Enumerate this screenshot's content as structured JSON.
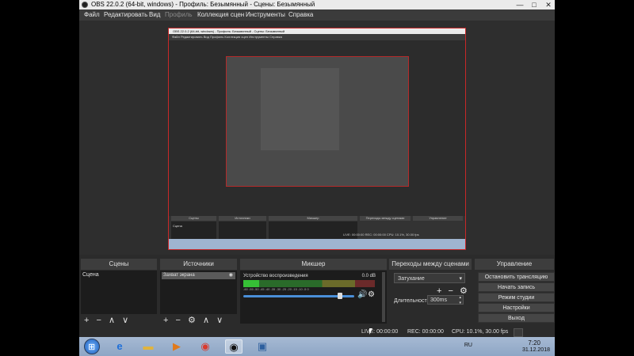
{
  "window": {
    "title": "OBS 22.0.2 (64-bit, windows) - Профиль: Безымянный - Сцены: Безымянный",
    "minimize_glyph": "—",
    "maximize_glyph": "□",
    "close_glyph": "✕"
  },
  "menu": {
    "items": [
      "Файл",
      "Редактировать",
      "Вид",
      "Профиль",
      "Коллекция сцен",
      "Инструменты",
      "Справка"
    ]
  },
  "preview": {
    "inner_title": "OBS 22.0.2 (64-bit, windows) - Профиль: Безымянный - Сцены: Безымянный",
    "inner_menu": "Файл  Редактировать  Вид  Профиль  Коллекция сцен  Инструменты  Справка",
    "inner_dock_titles": [
      "Сцены",
      "Источники",
      "Микшер",
      "Переходы между сценами",
      "Управление"
    ],
    "inner_scene_item": "Сцена",
    "inner_status": "LIVE: 00:00:00   REC: 00:00:00   CPU: 10.1%, 30.00 fps"
  },
  "docks": {
    "scenes": {
      "title": "Сцены",
      "items": [
        "Сцена"
      ],
      "controls": [
        "+",
        "−",
        "∧",
        "∨"
      ]
    },
    "sources": {
      "title": "Источники",
      "items": [
        "Захват экрана"
      ],
      "controls": [
        "+",
        "−",
        "⚙",
        "∧",
        "∨"
      ]
    },
    "mixer": {
      "title": "Микшер",
      "channel_label": "Устройство воспроизведения",
      "channel_db": "0.0 dB",
      "scale": "-60  -55  -50  -45  -40  -35  -30  -25  -20  -15  -10  -5  0",
      "volume": 0.85,
      "level": 0.12
    },
    "transitions": {
      "title": "Переходы между сценами",
      "selected": "Затухание",
      "controls": [
        "+",
        "−",
        "⚙"
      ],
      "duration_label": "Длительность",
      "duration_value": "300ms"
    },
    "controls": {
      "title": "Управление",
      "buttons": [
        "Остановить трансляцию",
        "Начать запись",
        "Режим студии",
        "Настройки",
        "Выход"
      ]
    }
  },
  "status": {
    "live": "LIVE: 00:00:00",
    "rec": "REC: 00:00:00",
    "cpu": "CPU: 10.1%, 30.00 fps"
  },
  "taskbar": {
    "start_icon": "windows-start-icon",
    "apps": [
      "windows-explorer-icon",
      "ie-icon",
      "folder-icon",
      "media-player-icon",
      "chrome-icon",
      "obs-icon",
      "image-viewer-icon"
    ],
    "language": "RU",
    "time": "7:20",
    "date": "31.12.2018"
  },
  "colors": {
    "preview_border": "#c82828",
    "panel_bg": "#2b2b2b",
    "slider": "#4a8fd8"
  }
}
